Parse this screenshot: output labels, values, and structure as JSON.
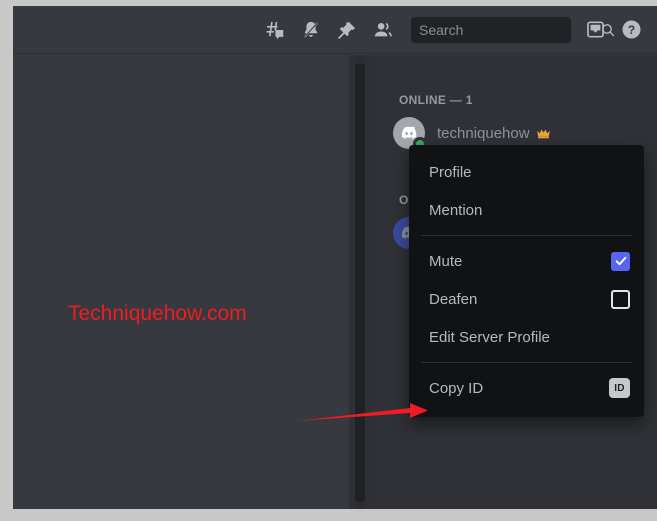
{
  "window": {
    "frame_color": "#c8c8c8",
    "chat_bg": "#36393f",
    "member_bg": "#2f3136",
    "menu_bg": "#111214",
    "accent": "#5865f2",
    "watermark_color": "#ef1d20",
    "annotation_color": "#ee1c24"
  },
  "toolbar": {
    "icons": [
      {
        "name": "threads-icon",
        "label": "Threads"
      },
      {
        "name": "bell-slash-icon",
        "label": "Notification Settings"
      },
      {
        "name": "pin-icon",
        "label": "Pinned Messages"
      },
      {
        "name": "members-icon",
        "label": "Member List"
      }
    ],
    "search": {
      "placeholder": "Search",
      "value": "",
      "icon": "search-icon"
    },
    "inbox": {
      "name": "inbox-icon",
      "label": "Inbox"
    },
    "help": {
      "name": "help-icon",
      "label": "Help",
      "glyph": "?"
    }
  },
  "chat": {
    "watermark": "Techniquehow.com"
  },
  "member_list": {
    "groups": [
      {
        "header": "ONLINE — 1",
        "members": [
          {
            "name": "techniquehow",
            "status": "online",
            "avatar_style": "gray",
            "badge": "crown-icon"
          }
        ]
      },
      {
        "header": "OFFLINE",
        "members": [
          {
            "name": "",
            "status": "offline",
            "avatar_style": "blurple",
            "badge": ""
          }
        ]
      }
    ]
  },
  "context_menu": {
    "items": [
      {
        "id": "profile",
        "label": "Profile",
        "type": "action",
        "trailing": ""
      },
      {
        "id": "mention",
        "label": "Mention",
        "type": "action",
        "trailing": ""
      },
      {
        "id": "separator-1",
        "label": "",
        "type": "separator",
        "trailing": ""
      },
      {
        "id": "mute",
        "label": "Mute",
        "type": "checkbox",
        "checked": true,
        "trailing": ""
      },
      {
        "id": "deafen",
        "label": "Deafen",
        "type": "checkbox",
        "checked": false,
        "trailing": ""
      },
      {
        "id": "edit-server-profile",
        "label": "Edit Server Profile",
        "type": "action",
        "trailing": ""
      },
      {
        "id": "separator-2",
        "label": "",
        "type": "separator",
        "trailing": ""
      },
      {
        "id": "copy-id",
        "label": "Copy ID",
        "type": "action",
        "trailing": "ID"
      }
    ]
  },
  "annotation": {
    "arrow_target": "Copy ID",
    "arrow_color": "#ee1c24"
  }
}
